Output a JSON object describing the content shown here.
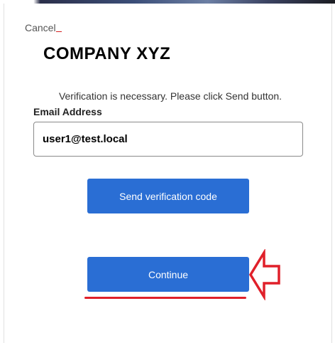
{
  "cancel": {
    "label": "Cancel"
  },
  "header": {
    "title": "COMPANY XYZ"
  },
  "intro": {
    "text": "Verification is necessary. Please click Send button."
  },
  "email": {
    "label": "Email Address",
    "value": "user1@test.local"
  },
  "buttons": {
    "send_label": "Send verification code",
    "continue_label": "Continue"
  },
  "annotations": {
    "arrow_icon": "arrow-left-icon",
    "highlight_color": "#e0202a"
  },
  "colors": {
    "primary_button": "#2a6ed4",
    "annotation_red": "#e0202a"
  }
}
